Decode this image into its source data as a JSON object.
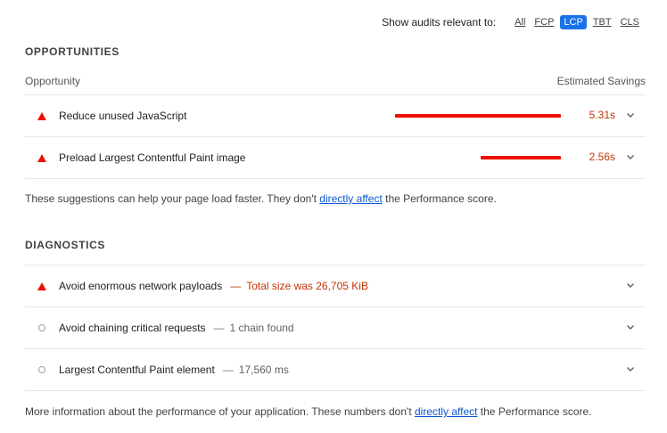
{
  "filter": {
    "label": "Show audits relevant to:",
    "chips": [
      "All",
      "FCP",
      "LCP",
      "TBT",
      "CLS"
    ],
    "active": "LCP"
  },
  "opportunities": {
    "title": "OPPORTUNITIES",
    "header_left": "Opportunity",
    "header_right": "Estimated Savings",
    "items": [
      {
        "title": "Reduce unused JavaScript",
        "savings": "5.31s",
        "savings_seconds": 5.31,
        "status": "fail"
      },
      {
        "title": "Preload Largest Contentful Paint image",
        "savings": "2.56s",
        "savings_seconds": 2.56,
        "status": "fail"
      }
    ],
    "note_before": "These suggestions can help your page load faster. They don't ",
    "note_link": "directly affect",
    "note_after": " the Performance score."
  },
  "diagnostics": {
    "title": "DIAGNOSTICS",
    "items": [
      {
        "title": "Avoid enormous network payloads",
        "separator": "—",
        "display": "Total size was 26,705 KiB",
        "status": "fail"
      },
      {
        "title": "Avoid chaining critical requests",
        "separator": "—",
        "display": "1 chain found",
        "status": "info"
      },
      {
        "title": "Largest Contentful Paint element",
        "separator": "—",
        "display": "17,560 ms",
        "status": "info"
      }
    ],
    "note_before": "More information about the performance of your application. These numbers don't ",
    "note_link": "directly affect",
    "note_after": " the Performance score."
  },
  "colors": {
    "fail": "#eb0f00",
    "fail_text": "#c33300",
    "active_chip": "#1a73e8",
    "link": "#0b57d0"
  },
  "icons": {
    "fail": "red-triangle-icon",
    "info": "gray-circle-icon",
    "expand": "chevron-down-icon"
  }
}
